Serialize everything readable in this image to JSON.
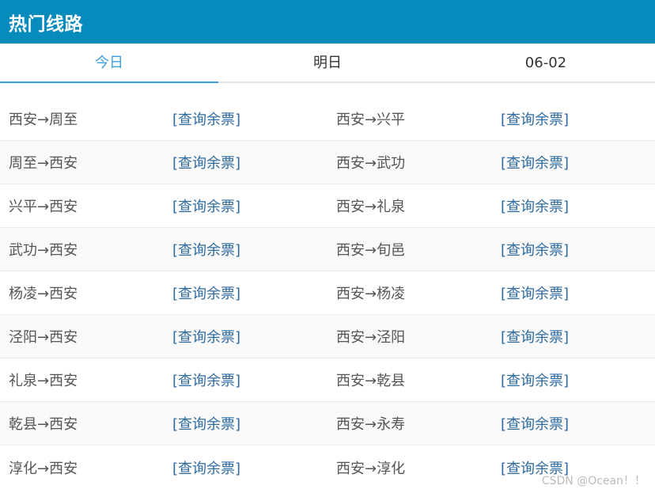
{
  "header": {
    "title": "热门线路"
  },
  "tabs": [
    {
      "label": "今日",
      "active": true
    },
    {
      "label": "明日",
      "active": false
    },
    {
      "label": "06-02",
      "active": false
    }
  ],
  "query_label": "[查询余票]",
  "rows": [
    {
      "left_route": "西安→周至",
      "right_route": "西安→兴平"
    },
    {
      "left_route": "周至→西安",
      "right_route": "西安→武功"
    },
    {
      "left_route": "兴平→西安",
      "right_route": "西安→礼泉"
    },
    {
      "left_route": "武功→西安",
      "right_route": "西安→旬邑"
    },
    {
      "left_route": "杨凌→西安",
      "right_route": "西安→杨凌"
    },
    {
      "left_route": "泾阳→西安",
      "right_route": "西安→泾阳"
    },
    {
      "left_route": "礼泉→西安",
      "right_route": "西安→乾县"
    },
    {
      "left_route": "乾县→西安",
      "right_route": "西安→永寿"
    },
    {
      "left_route": "淳化→西安",
      "right_route": "西安→淳化"
    }
  ],
  "watermark": "CSDN @Ocean！！",
  "colors": {
    "header_bg": "#078bbd",
    "active_tab": "#3d9fe0",
    "link": "#2c6aa0"
  }
}
